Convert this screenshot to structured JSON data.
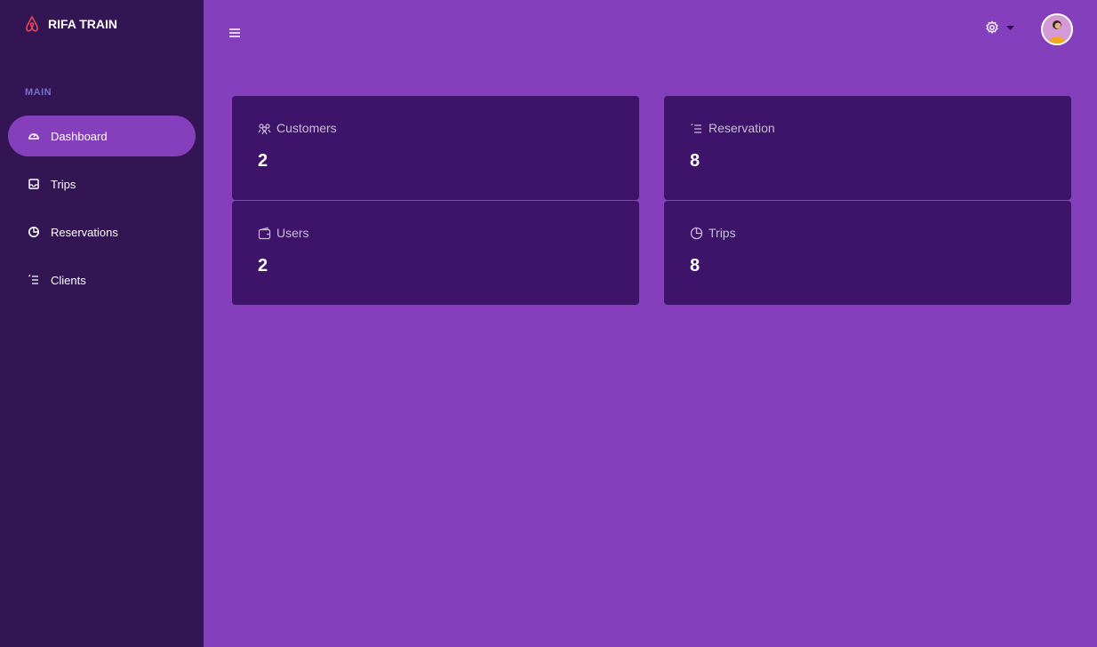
{
  "brand": {
    "name": "RIFA TRAIN",
    "logo_icon": "airbnb-logo-icon",
    "logo_color": "#e0475a"
  },
  "sidebar": {
    "section": "MAIN",
    "items": [
      {
        "label": "Dashboard",
        "icon": "dashboard-icon",
        "active": true
      },
      {
        "label": "Trips",
        "icon": "inbox-icon"
      },
      {
        "label": "Reservations",
        "icon": "pie-chart-icon"
      },
      {
        "label": "Clients",
        "icon": "list-icon"
      }
    ]
  },
  "header": {
    "menu_icon": "hamburger-icon",
    "settings_icon": "gear-icon",
    "avatar": "user-avatar"
  },
  "cards": [
    {
      "label": "Customers",
      "value": "2",
      "icon": "users-icon"
    },
    {
      "label": "Reservation",
      "value": "8",
      "icon": "list-icon"
    },
    {
      "label": "Users",
      "value": "2",
      "icon": "wallet-icon"
    },
    {
      "label": "Trips",
      "value": "8",
      "icon": "pie-chart-icon"
    }
  ],
  "colors": {
    "sidebar": "#321552",
    "main": "#853fbd",
    "card": "#3e146a",
    "accent": "#853fbd"
  }
}
